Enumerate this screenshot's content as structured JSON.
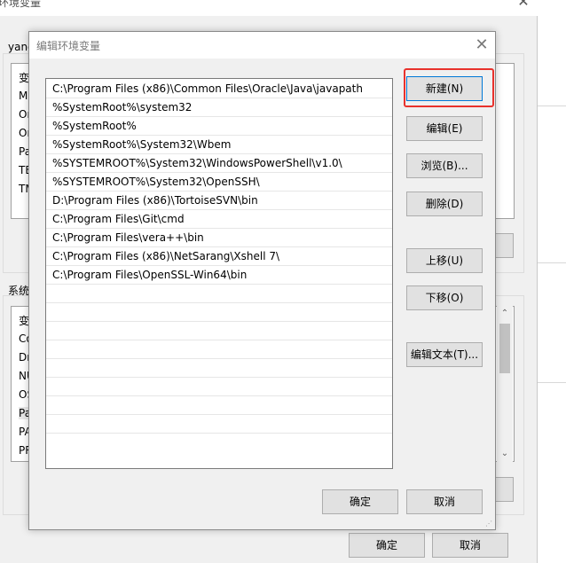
{
  "background_window": {
    "title": "环境变量",
    "user_group_label": "yang",
    "user_list": [
      "变",
      "M",
      "Or",
      "Or",
      "Pa",
      "TE",
      "TM"
    ],
    "system_group_label": "系统",
    "system_list": [
      "变",
      "Co",
      "Dr",
      "NU",
      "OS",
      "Pa",
      "PA",
      "PR"
    ],
    "ok_label": "确定",
    "cancel_label": "取消"
  },
  "dialog": {
    "title": "编辑环境变量",
    "paths": [
      "C:\\Program Files (x86)\\Common Files\\Oracle\\Java\\javapath",
      "%SystemRoot%\\system32",
      "%SystemRoot%",
      "%SystemRoot%\\System32\\Wbem",
      "%SYSTEMROOT%\\System32\\WindowsPowerShell\\v1.0\\",
      "%SYSTEMROOT%\\System32\\OpenSSH\\",
      "D:\\Program Files (x86)\\TortoiseSVN\\bin",
      "C:\\Program Files\\Git\\cmd",
      "C:\\Program Files\\vera++\\bin",
      "C:\\Program Files (x86)\\NetSarang\\Xshell 7\\",
      "C:\\Program Files\\OpenSSL-Win64\\bin"
    ],
    "buttons": {
      "new": "新建(N)",
      "edit": "编辑(E)",
      "browse": "浏览(B)...",
      "delete": "删除(D)",
      "move_up": "上移(U)",
      "move_down": "下移(O)",
      "edit_text": "编辑文本(T)..."
    },
    "ok_label": "确定",
    "cancel_label": "取消"
  },
  "colors": {
    "highlight": "#e8322c",
    "dialog_bg": "#f0f0f0",
    "button_bg": "#e1e1e1"
  }
}
